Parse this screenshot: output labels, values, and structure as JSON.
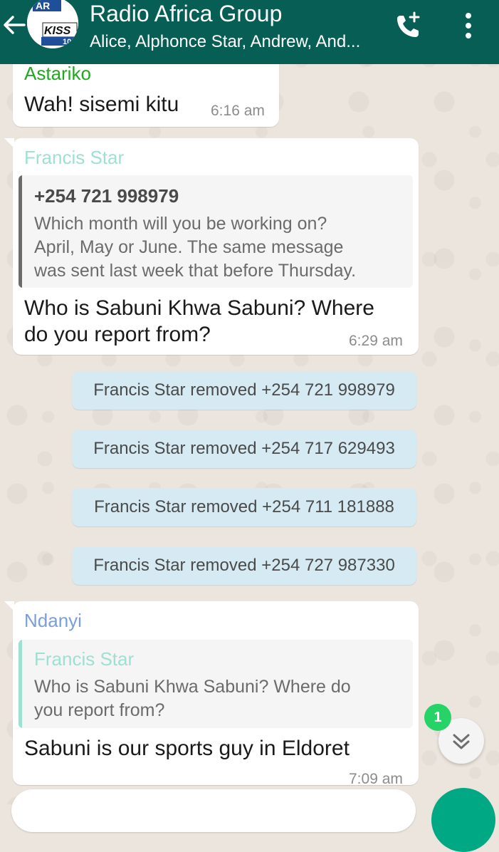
{
  "header": {
    "title": "Radio Africa Group",
    "participants": "Alice, Alphonce Star, Andrew, And...",
    "avatar_text_top": "AR",
    "avatar_text_logo": "KISS",
    "avatar_text_sub": "10"
  },
  "messages": [
    {
      "sender": "Astariko",
      "sender_color": "#1fa91f",
      "text": "Wah! sisemi kitu",
      "time": "6:16 am"
    },
    {
      "sender": "Francis Star",
      "sender_color": "#9ee0d2",
      "quote": {
        "name": "+254 721 998979",
        "name_color": "#4a4a4a",
        "bar_color": "#6b6b6b",
        "lines": [
          "Which month will you be working on?",
          "April, May or June. The same message",
          "was sent last week that before Thursday."
        ]
      },
      "lines": [
        "Who is Sabuni Khwa Sabuni? Where",
        "do you report from?"
      ],
      "time": "6:29 am"
    },
    {
      "sender": "Ndanyi",
      "sender_color": "#7a9fd8",
      "quote": {
        "name": "Francis Star",
        "name_color": "#9ee0d2",
        "bar_color": "#9ee0d2",
        "lines": [
          "Who is Sabuni Khwa Sabuni? Where do",
          "you report from?"
        ]
      },
      "text": "Sabuni is our sports guy in Eldoret",
      "time": "7:09 am"
    }
  ],
  "system_messages": [
    "Francis Star removed +254 721 998979",
    "Francis Star removed +254 717 629493",
    "Francis Star removed +254 711 181888",
    "Francis Star removed +254 727 987330"
  ],
  "unread_count": "1",
  "icons": {
    "back": "arrow-left-icon",
    "call": "add-call-icon",
    "menu": "more-vertical-icon",
    "scroll": "chevron-double-down-icon"
  }
}
